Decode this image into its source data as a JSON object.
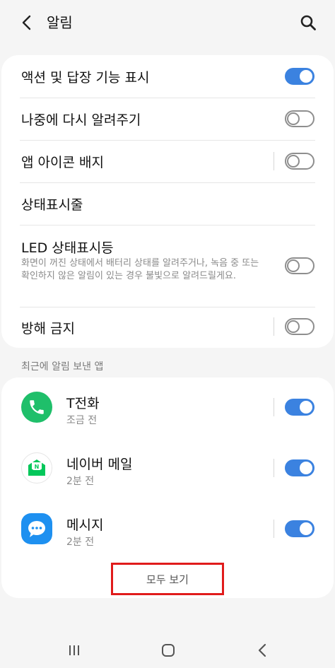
{
  "header": {
    "title": "알림"
  },
  "settings": {
    "action_reply": {
      "label": "액션 및 답장 기능 표시",
      "enabled": true
    },
    "remind_later": {
      "label": "나중에 다시 알려주기",
      "enabled": false
    },
    "app_icon_badge": {
      "label": "앱 아이콘 배지",
      "enabled": false
    },
    "status_bar": {
      "label": "상태표시줄"
    },
    "led_indicator": {
      "label": "LED 상태표시등",
      "description": "화면이 꺼진 상태에서 배터리 상태를 알려주거나, 녹음 중 또는 확인하지 않은 알림이 있는 경우 불빛으로 알려드릴게요.",
      "enabled": false
    },
    "do_not_disturb": {
      "label": "방해 금지",
      "enabled": false
    }
  },
  "recent": {
    "section_label": "최근에 알림 보낸 앱",
    "apps": [
      {
        "name": "T전화",
        "time": "조금 전",
        "icon": "phone-icon",
        "enabled": true
      },
      {
        "name": "네이버 메일",
        "time": "2분 전",
        "icon": "naver-mail-icon",
        "enabled": true
      },
      {
        "name": "메시지",
        "time": "2분 전",
        "icon": "message-icon",
        "enabled": true
      }
    ],
    "view_all": "모두 보기"
  },
  "colors": {
    "accent": "#3b82e0",
    "highlight": "#e01b1b",
    "phone_app": "#1fbf6a",
    "naver_green": "#03c75a",
    "message_app": "#1e90f0"
  }
}
